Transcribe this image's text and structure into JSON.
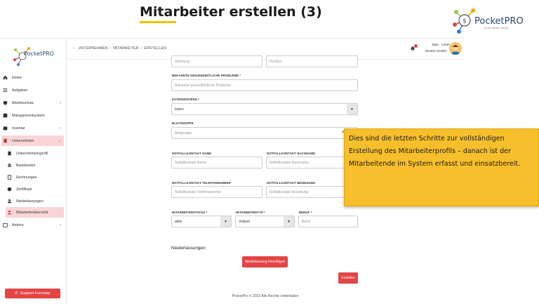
{
  "slide": {
    "title": "Mitarbeiter erstellen (3)",
    "brand": "PocketPRO",
    "brand_sub": "profit. smart. Erfolg",
    "accent_color": "#f2c200"
  },
  "sidebar": {
    "logo_text": "PocketPRO",
    "items": [
      {
        "label": "Home",
        "icon": "home-icon"
      },
      {
        "label": "Aufgaben",
        "icon": "list-icon"
      },
      {
        "label": "Arbeitsschutz",
        "icon": "shield-icon"
      },
      {
        "label": "Managementsystem",
        "icon": "grid-icon"
      },
      {
        "label": "Inventar",
        "icon": "box-icon"
      },
      {
        "label": "Unternehmen",
        "icon": "building-icon"
      },
      {
        "label": "Andere",
        "icon": "folder-icon"
      }
    ],
    "subitems": [
      {
        "label": "Unternehmensprofil",
        "icon": "document-icon"
      },
      {
        "label": "Bankkonten",
        "icon": "bank-icon"
      },
      {
        "label": "Rechnungen",
        "icon": "invoice-icon"
      },
      {
        "label": "Zertifikate",
        "icon": "badge-icon"
      },
      {
        "label": "Niederlassungen",
        "icon": "branch-icon"
      },
      {
        "label": "Mitarbeiterübersicht",
        "icon": "users-icon"
      }
    ],
    "support_label": "Support-Formular"
  },
  "topbar": {
    "breadcrumb": [
      "UNTERNEHMEN",
      "MITARBEITER",
      "ERSTELLEN"
    ],
    "user_name": "Max - Leiter",
    "user_company": "Muster GmbH"
  },
  "form": {
    "abteilung_placeholder": "Abteilung",
    "position_placeholder": "Position",
    "health_label": "BEKANNTE GESUNDHEITLICHE PROBLEME *",
    "health_placeholder": "Bekannte gesundheitliche Probleme",
    "extern_label": "EXTERN/INTERN *",
    "extern_value": "Intern",
    "blood_label": "BLUTGRUPPE",
    "blood_placeholder": "Blutgruppe",
    "emergency_name_label": "NOTFALLKONTAKT NAME",
    "emergency_name_placeholder": "Notfallkontakt Name",
    "emergency_lastname_label": "NOTFALLKONTAKT NACHNAME",
    "emergency_lastname_placeholder": "Notfallkontakt Nachname",
    "emergency_phone_label": "NOTFALLKONTAKT TELEFONNUMMER",
    "emergency_phone_placeholder": "Notfallkontakt Telefonnummer",
    "emergency_relation_label": "NOTFALLKONTAKT BEZIEHUNG",
    "emergency_relation_placeholder": "Notfallkontakt Beziehung",
    "status_label": "MITARBEITERSTATUS *",
    "status_value": "aktiv",
    "type_label": "MITARBEITERTYP *",
    "type_value": "Vollzeit",
    "job_label": "BERUF *",
    "job_placeholder": "Beruf",
    "branches_title": "Niederlassungen",
    "add_branch_label": "Niederlassung hinzufügen",
    "submit_label": "Erstellen"
  },
  "footer": "PocketPro © 2023 Alle Rechte vorbehalten",
  "tooltip": "Dies sind die letzten Schritte zur vollständigen Erstellung des Mitarbeiterprofils – danach ist der Mitarbeitende im System erfasst und einsatzbereit."
}
